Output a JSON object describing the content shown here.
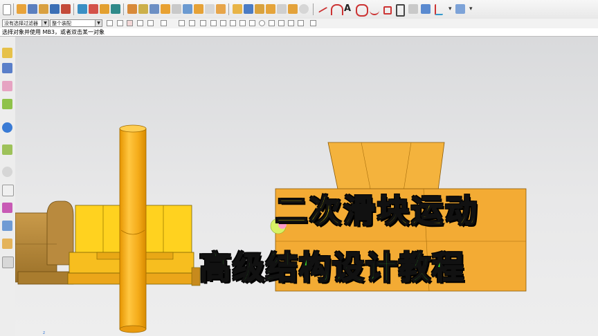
{
  "filters": {
    "selection_filter": "没有选择过滤器",
    "assembly_scope": "整个装配"
  },
  "status": {
    "prompt": "选择对象并使用 MB3，或者双击某一对象"
  },
  "overlay": {
    "line1": "二次滑块运动",
    "line2": "高级结构设计教程"
  },
  "colors": {
    "part_orange": "#f4b33d",
    "part_dark": "#c98a1c",
    "part_yellow": "#ffd21f",
    "fixture_brown": "#b88a3c",
    "caption_line1": "#fff200",
    "caption_line2": "#3ddc2f"
  },
  "toolbar_icons": [
    "new-file-icon",
    "open-icon",
    "wrench-icon",
    "part-icon",
    "sketch-icon",
    "extrude-icon",
    "revolve-icon",
    "hole-icon",
    "boss-icon",
    "pocket-icon",
    "pad-icon",
    "slot-icon",
    "groove-icon",
    "edge-blend-icon",
    "chamfer-icon",
    "shell-icon",
    "draft-icon",
    "trim-icon",
    "split-icon",
    "mirror-icon",
    "pattern-icon",
    "sew-icon",
    "offset-icon",
    "scale-icon",
    "line-icon",
    "arc-icon",
    "text-icon",
    "curve-icon",
    "spline-icon",
    "point-icon",
    "datum-icon",
    "csys-icon",
    "view-icon"
  ]
}
